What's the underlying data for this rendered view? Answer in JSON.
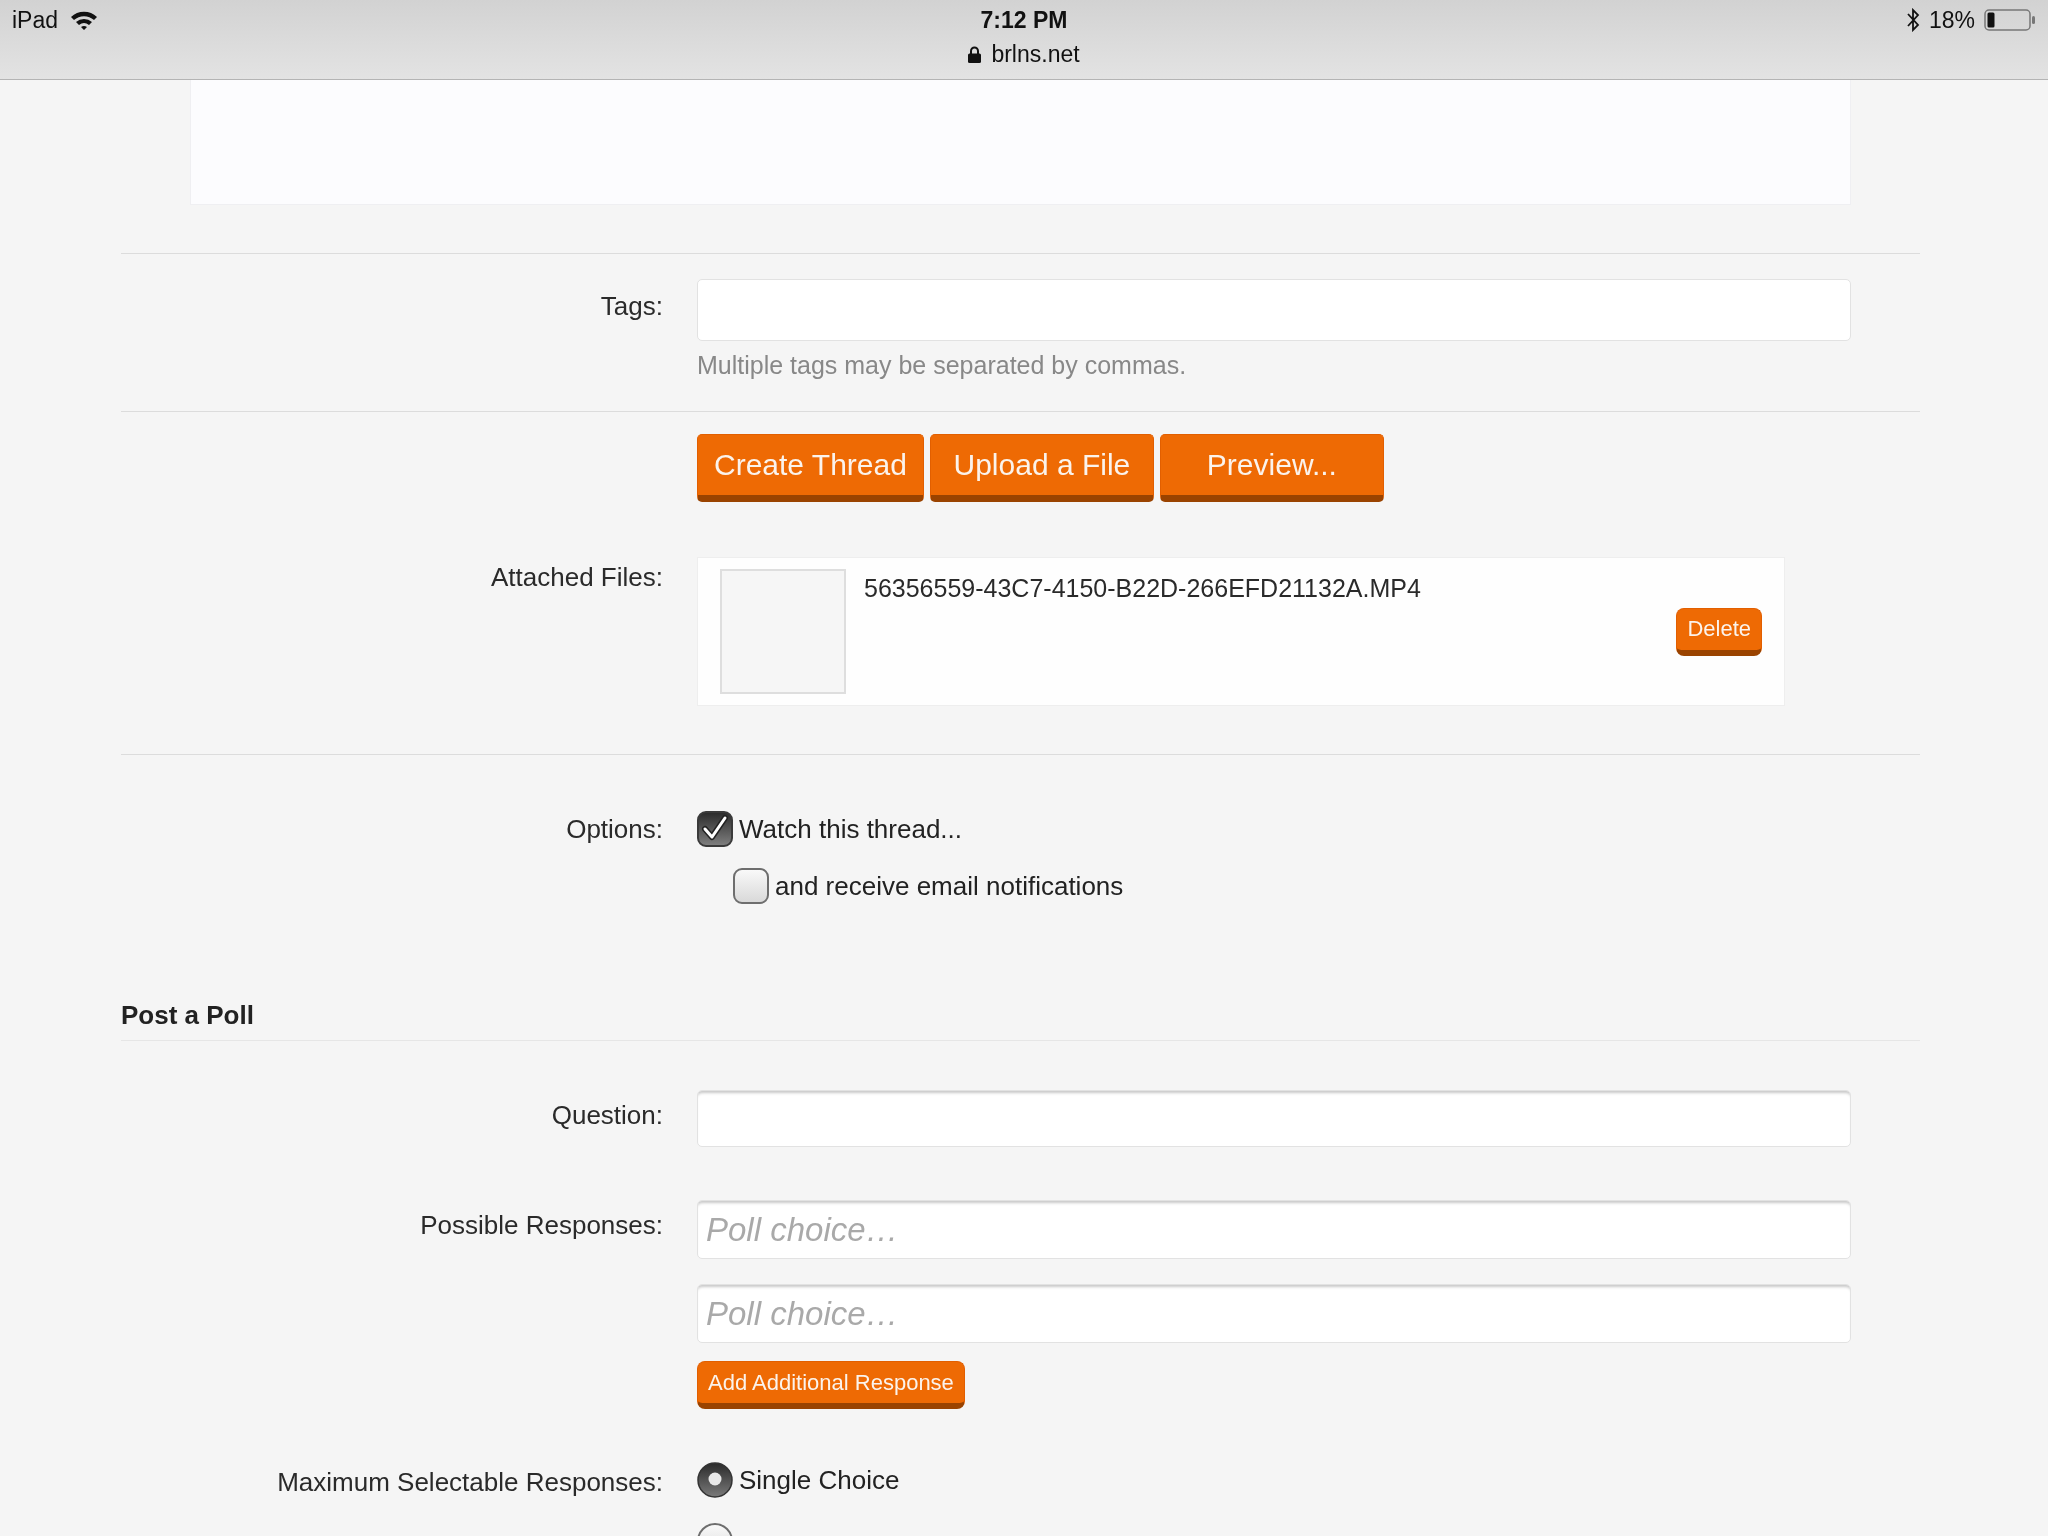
{
  "status_bar": {
    "device": "iPad",
    "time": "7:12 PM",
    "url": "brlns.net",
    "battery": "18%"
  },
  "tags": {
    "label": "Tags:",
    "hint": "Multiple tags may be separated by commas."
  },
  "actions": [
    "Create Thread",
    "Upload a File",
    "Preview..."
  ],
  "attached_files": {
    "label": "Attached Files:",
    "files": [
      {
        "name": "56356559-43C7-4150-B22D-266EFD21132A.MP4",
        "action": "Delete"
      }
    ]
  },
  "options": {
    "label": "Options:",
    "items": [
      {
        "label": "Watch this thread...",
        "checked": true,
        "children": [
          {
            "label": "and receive email notifications",
            "checked": false
          }
        ]
      }
    ]
  },
  "poll": {
    "title": "Post a Poll",
    "question": {
      "label": "Question:"
    },
    "responses": {
      "label": "Possible Responses:",
      "fields": [
        {
          "placeholder": "Poll choice…"
        },
        {
          "placeholder": "Poll choice…"
        }
      ],
      "add_button": "Add Additional Response"
    },
    "max_selectable": {
      "label": "Maximum Selectable Responses:",
      "choices": [
        {
          "label": "Single Choice",
          "selected": true
        },
        {
          "selected": false
        }
      ]
    }
  }
}
